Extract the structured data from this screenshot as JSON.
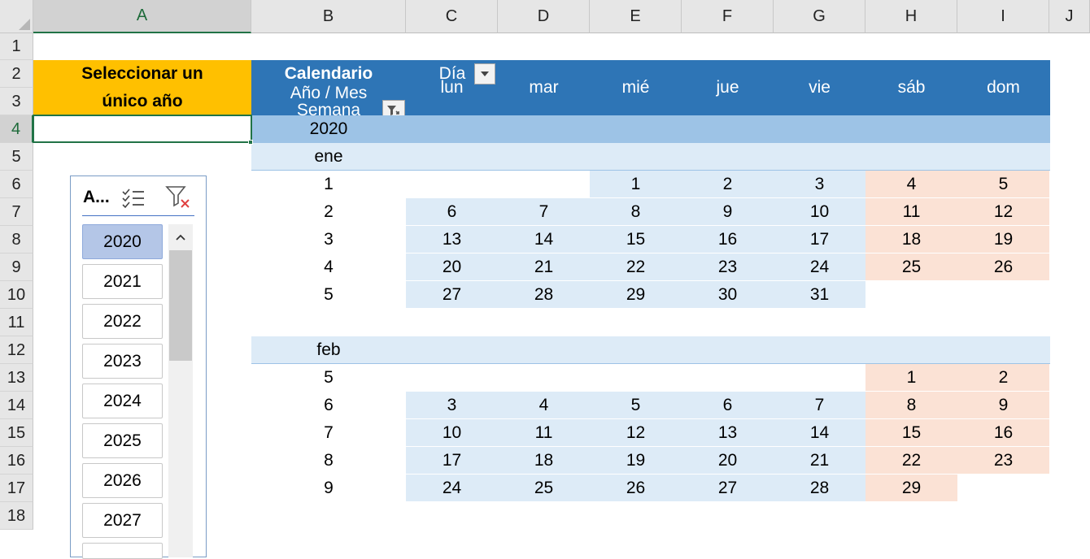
{
  "columns": [
    "A",
    "B",
    "C",
    "D",
    "E",
    "F",
    "G",
    "H",
    "I",
    "J"
  ],
  "rows": [
    "1",
    "2",
    "3",
    "4",
    "5",
    "6",
    "7",
    "8",
    "9",
    "10",
    "11",
    "12",
    "13",
    "14",
    "15",
    "16",
    "17",
    "18"
  ],
  "header": {
    "a_label": "Seleccionar un único año",
    "calendario": "Calendario",
    "dia": "Día",
    "ano_mes": "Año / Mes",
    "semana": "Semana",
    "days": [
      "lun",
      "mar",
      "mié",
      "jue",
      "vie",
      "sáb",
      "dom"
    ]
  },
  "pivot": {
    "year": "2020",
    "months": [
      {
        "name": "ene",
        "weeks": [
          {
            "week": "1",
            "days": [
              "",
              "",
              "1",
              "2",
              "3",
              "4",
              "5"
            ]
          },
          {
            "week": "2",
            "days": [
              "6",
              "7",
              "8",
              "9",
              "10",
              "11",
              "12"
            ]
          },
          {
            "week": "3",
            "days": [
              "13",
              "14",
              "15",
              "16",
              "17",
              "18",
              "19"
            ]
          },
          {
            "week": "4",
            "days": [
              "20",
              "21",
              "22",
              "23",
              "24",
              "25",
              "26"
            ]
          },
          {
            "week": "5",
            "days": [
              "27",
              "28",
              "29",
              "30",
              "31",
              "",
              ""
            ]
          }
        ]
      },
      {
        "name": "feb",
        "weeks": [
          {
            "week": "5",
            "days": [
              "",
              "",
              "",
              "",
              "",
              "1",
              "2"
            ]
          },
          {
            "week": "6",
            "days": [
              "3",
              "4",
              "5",
              "6",
              "7",
              "8",
              "9"
            ]
          },
          {
            "week": "7",
            "days": [
              "10",
              "11",
              "12",
              "13",
              "14",
              "15",
              "16"
            ]
          },
          {
            "week": "8",
            "days": [
              "17",
              "18",
              "19",
              "20",
              "21",
              "22",
              "23"
            ]
          },
          {
            "week": "9",
            "days": [
              "24",
              "25",
              "26",
              "27",
              "28",
              "29",
              ""
            ]
          }
        ]
      }
    ]
  },
  "slicer": {
    "title": "A...",
    "items": [
      "2020",
      "2021",
      "2022",
      "2023",
      "2024",
      "2025",
      "2026",
      "2027"
    ],
    "selected": "2020"
  },
  "colors": {
    "header_blue": "#2e75b6",
    "year_band": "#9dc3e6",
    "light_band": "#ddebf7",
    "weekend": "#fbe2d5",
    "label_yellow": "#ffc000",
    "selection_green": "#217346"
  }
}
